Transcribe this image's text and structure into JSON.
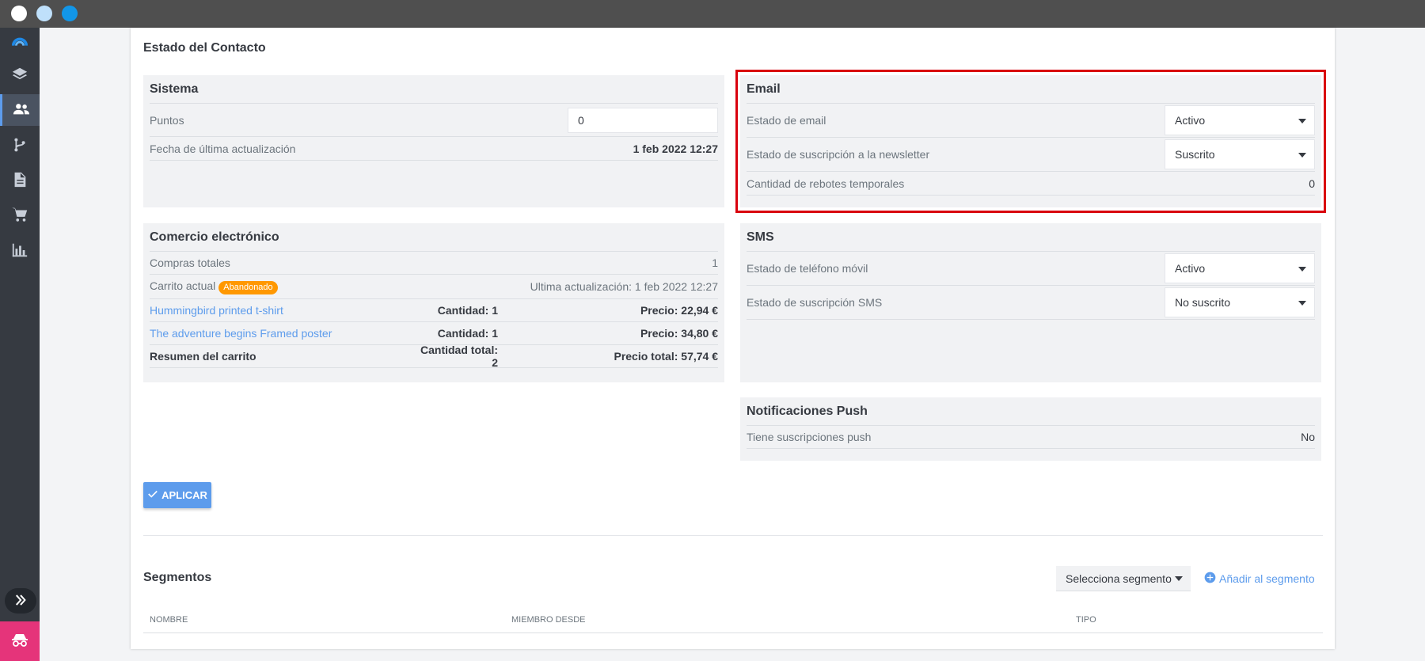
{
  "sidebar": {
    "icons": [
      "logo-icon",
      "layers-icon",
      "contacts-icon",
      "flow-icon",
      "document-icon",
      "cart-icon",
      "chart-icon"
    ],
    "active": "contacts-icon"
  },
  "page": {
    "title": "Estado del Contacto"
  },
  "sistema": {
    "title": "Sistema",
    "puntos_label": "Puntos",
    "puntos_value": "0",
    "fecha_label": "Fecha de última actualización",
    "fecha_value": "1 feb 2022 12:27"
  },
  "email": {
    "title": "Email",
    "estado_label": "Estado de email",
    "estado_value": "Activo",
    "newsletter_label": "Estado de suscripción a la newsletter",
    "newsletter_value": "Suscrito",
    "rebotes_label": "Cantidad de rebotes temporales",
    "rebotes_value": "0"
  },
  "comercio": {
    "title": "Comercio electrónico",
    "compras_label": "Compras totales",
    "compras_value": "1",
    "carrito_label": "Carrito actual",
    "carrito_badge": "Abandonado",
    "carrito_update": "Ultima actualización: 1 feb 2022 12:27",
    "items": [
      {
        "name": "Hummingbird printed t-shirt",
        "qty": "Cantidad: 1",
        "price": "Precio: 22,94 €"
      },
      {
        "name": "The adventure begins Framed poster",
        "qty": "Cantidad: 1",
        "price": "Precio: 34,80 €"
      }
    ],
    "summary_label": "Resumen del carrito",
    "summary_qty": "Cantidad total: 2",
    "summary_price": "Precio total: 57,74 €"
  },
  "sms": {
    "title": "SMS",
    "movil_label": "Estado de teléfono móvil",
    "movil_value": "Activo",
    "suscripcion_label": "Estado de suscripción SMS",
    "suscripcion_value": "No suscrito"
  },
  "push": {
    "title": "Notificaciones Push",
    "label": "Tiene suscripciones push",
    "value": "No"
  },
  "apply_label": "APLICAR",
  "segmentos": {
    "title": "Segmentos",
    "select_placeholder": "Selecciona segmento",
    "add_label": "Añadir al segmento",
    "columns": [
      "NOMBRE",
      "MIEMBRO DESDE",
      "TIPO"
    ]
  }
}
